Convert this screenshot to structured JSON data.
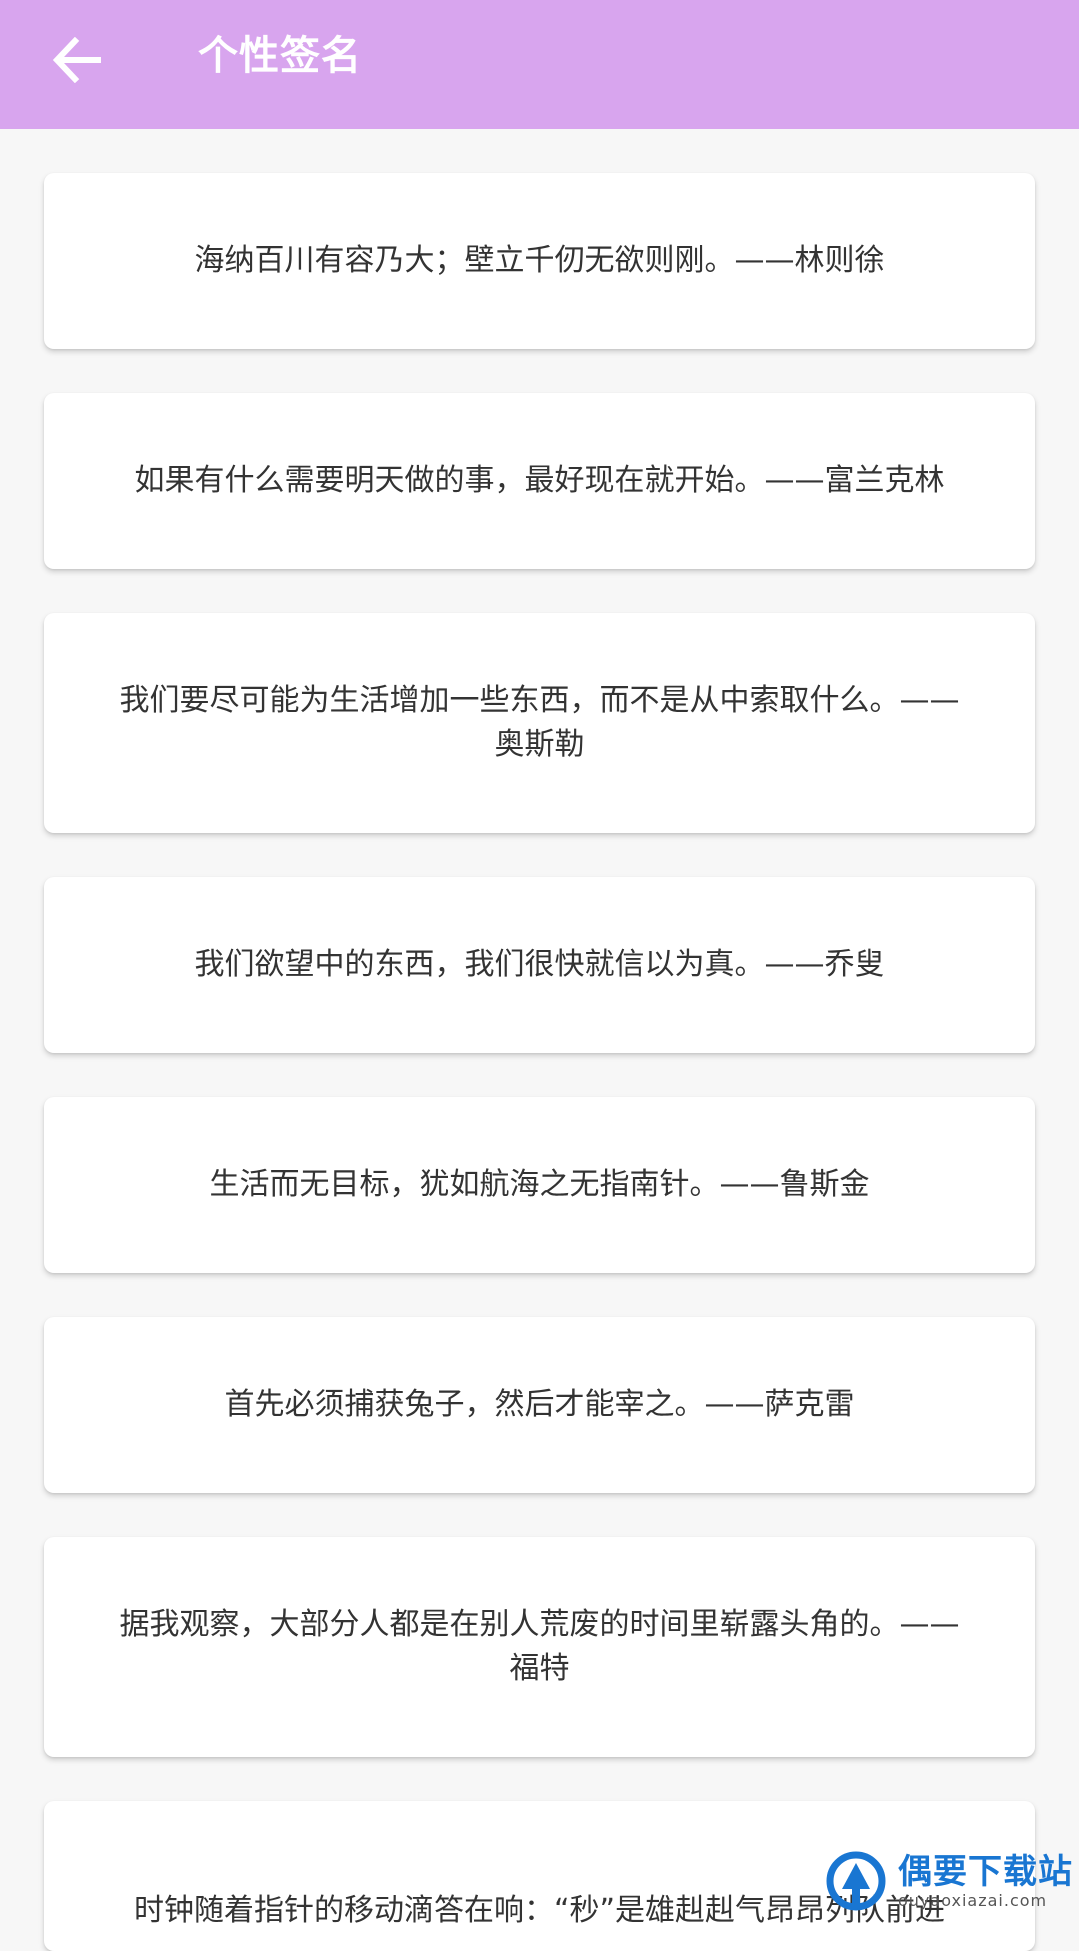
{
  "header": {
    "title": "个性签名",
    "back_icon": "arrow-left-icon",
    "background_color": "#d8a5ee",
    "text_color": "#ffffff"
  },
  "quotes": [
    {
      "text": "海纳百川有容乃大；壁立千仞无欲则刚。——林则徐"
    },
    {
      "text": "如果有什么需要明天做的事，最好现在就开始。——富兰克林"
    },
    {
      "text": "我们要尽可能为生活增加一些东西，而不是从中索取什么。——奥斯勒"
    },
    {
      "text": "我们欲望中的东西，我们很快就信以为真。——乔叟"
    },
    {
      "text": "生活而无目标，犹如航海之无指南针。——鲁斯金"
    },
    {
      "text": "首先必须捕获兔子，然后才能宰之。——萨克雷"
    },
    {
      "text": "据我观察，大部分人都是在别人荒废的时间里崭露头角的。——福特"
    },
    {
      "text": "时钟随着指针的移动滴答在响：“秒”是雄赳赳气昂昂列队前进"
    }
  ],
  "watermark": {
    "title": "偶要下载站",
    "subtitle": "ouyaoxiazai.com",
    "logo_icon": "watermark-logo-icon"
  }
}
